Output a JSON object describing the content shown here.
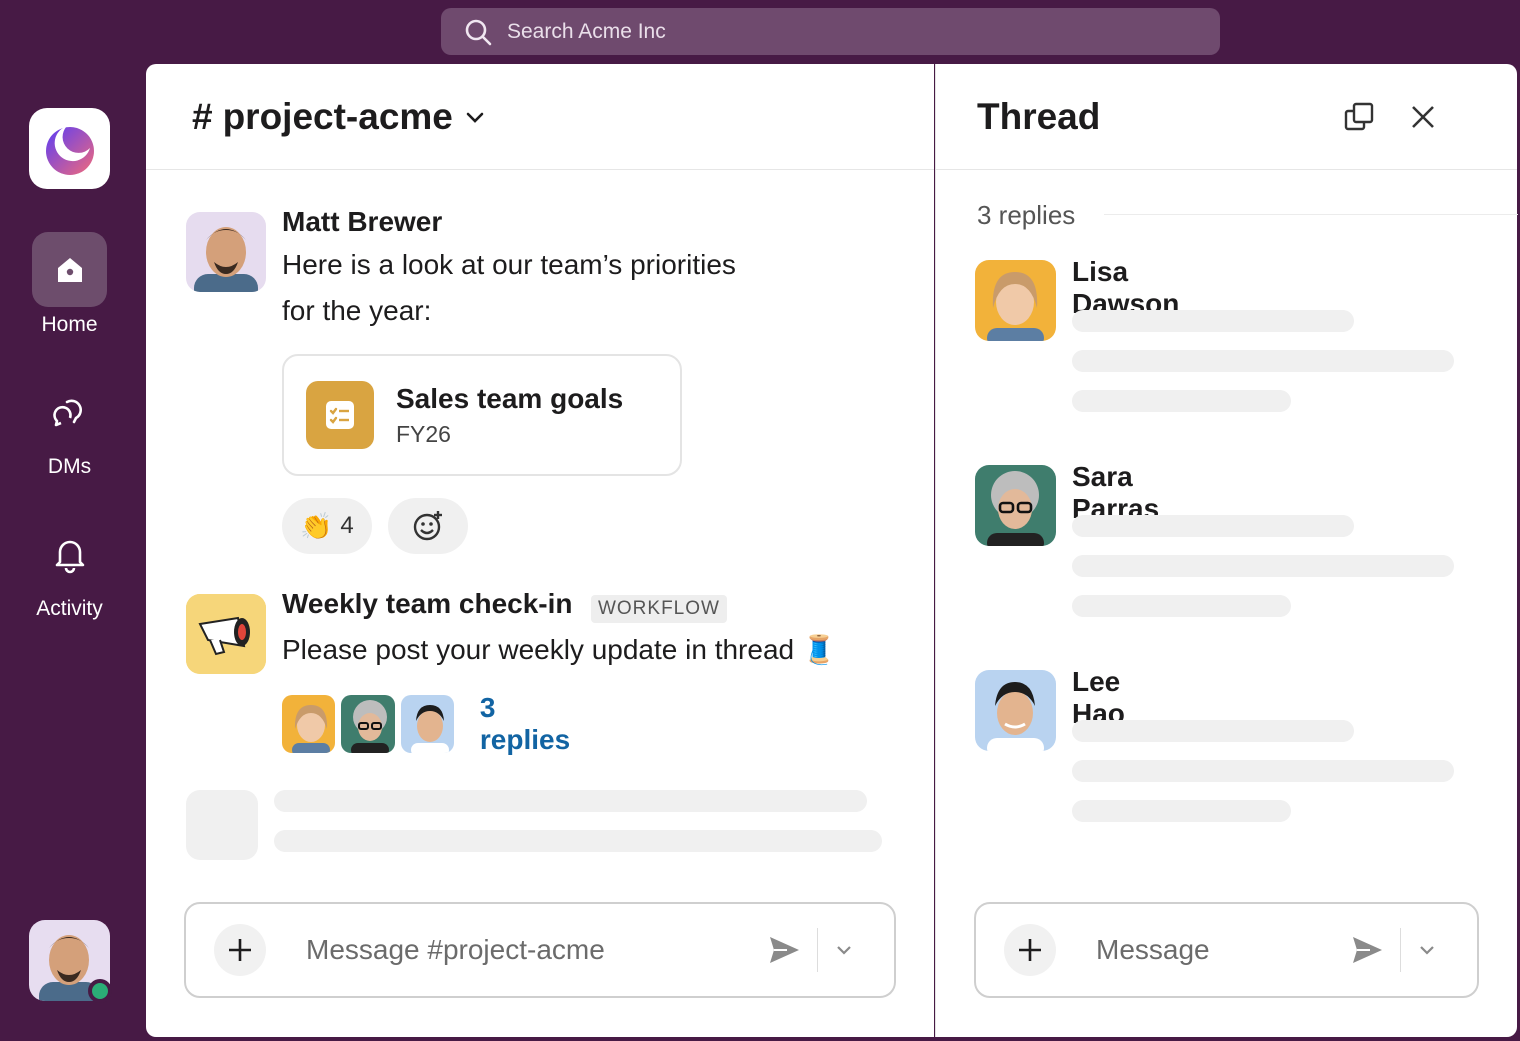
{
  "search": {
    "placeholder": "Search Acme Inc"
  },
  "rail": {
    "items": [
      {
        "label": "Home"
      },
      {
        "label": "DMs"
      },
      {
        "label": "Activity"
      }
    ]
  },
  "channel": {
    "hash": "#",
    "name": "project-acme"
  },
  "messages": {
    "m1": {
      "author": "Matt Brewer",
      "text_line1": "Here is a look at our team’s priorities",
      "text_line2": "for the year:",
      "card": {
        "title": "Sales team goals",
        "subtitle": "FY26"
      },
      "reactions": [
        {
          "emoji": "👏",
          "count": "4"
        }
      ]
    },
    "m2": {
      "author": "Weekly team check-in",
      "tag": "WORKFLOW",
      "text": "Please post your weekly update in thread 🧵",
      "replies_link": "3 replies"
    }
  },
  "composer": {
    "placeholder": "Message #project-acme"
  },
  "thread": {
    "title": "Thread",
    "count": "3 replies",
    "replies": [
      {
        "author": "Lisa Dawson"
      },
      {
        "author": "Sara Parras"
      },
      {
        "author": "Lee Hao"
      }
    ],
    "composer_placeholder": "Message"
  },
  "colors": {
    "aubergine": "#471a45",
    "link": "#1264a3",
    "presence": "#2bac76",
    "card_icon": "#d9a441"
  }
}
